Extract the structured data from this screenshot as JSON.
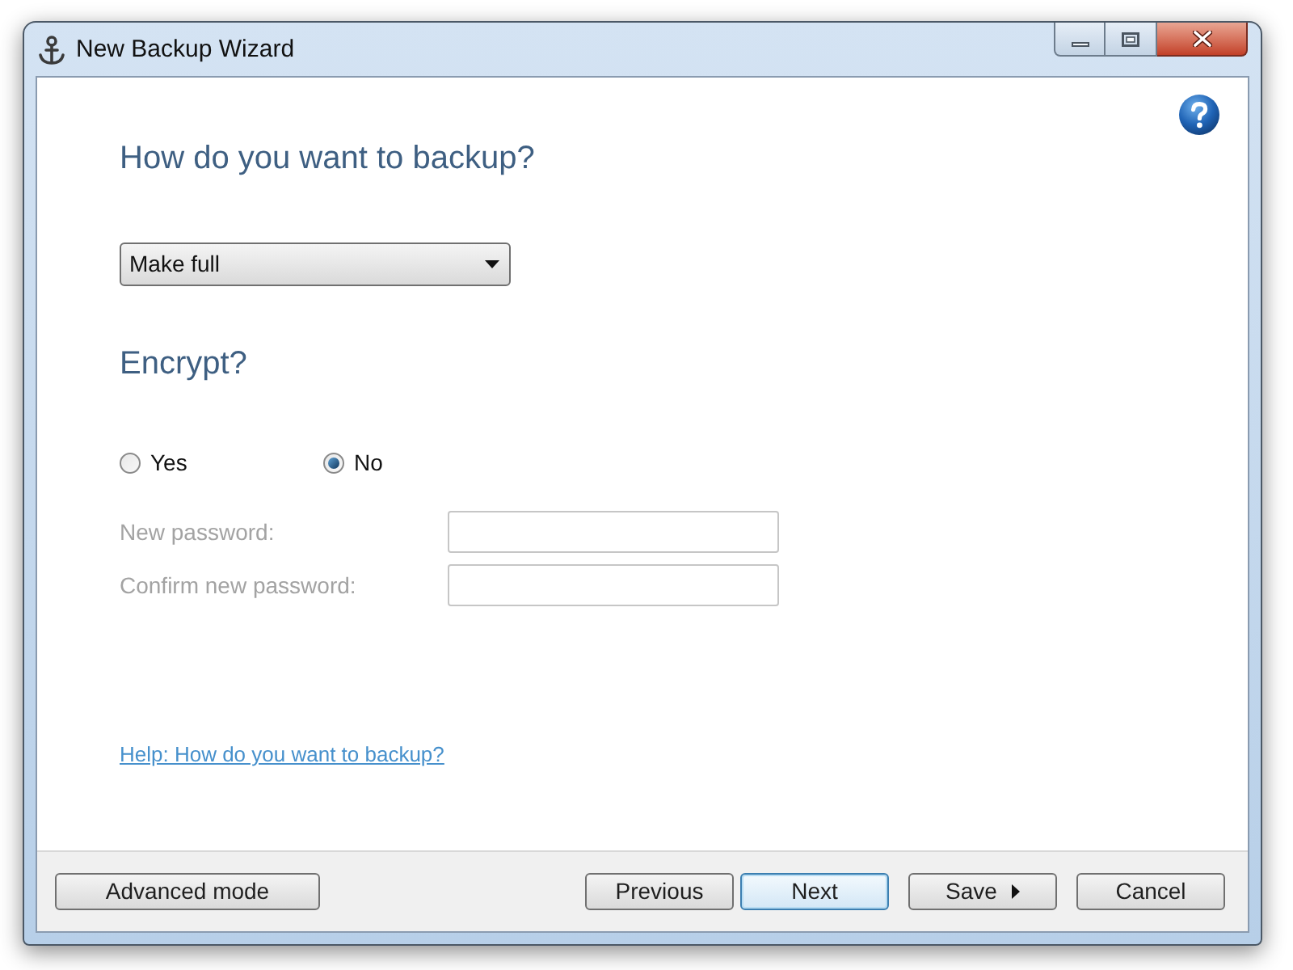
{
  "window": {
    "title": "New Backup Wizard"
  },
  "backup_section": {
    "heading": "How do you want to backup?",
    "dropdown": {
      "value": "Make full"
    }
  },
  "encrypt_section": {
    "heading": "Encrypt?",
    "options": [
      {
        "label": "Yes",
        "selected": false
      },
      {
        "label": "No",
        "selected": true
      }
    ],
    "fields": [
      {
        "label": "New password:",
        "disabled": true
      },
      {
        "label": "Confirm new password:",
        "disabled": true
      }
    ]
  },
  "help_link": "Help: How do you want to backup?",
  "footer": {
    "left_buttons": [
      {
        "label": "Advanced mode",
        "default": false,
        "menu": false
      }
    ],
    "right_buttons": [
      {
        "label": "Previous",
        "default": false,
        "menu": false
      },
      {
        "label": "Next",
        "default": true,
        "menu": false
      },
      {
        "label": "Save",
        "default": false,
        "menu": true
      },
      {
        "label": "Cancel",
        "default": false,
        "menu": false
      }
    ]
  }
}
